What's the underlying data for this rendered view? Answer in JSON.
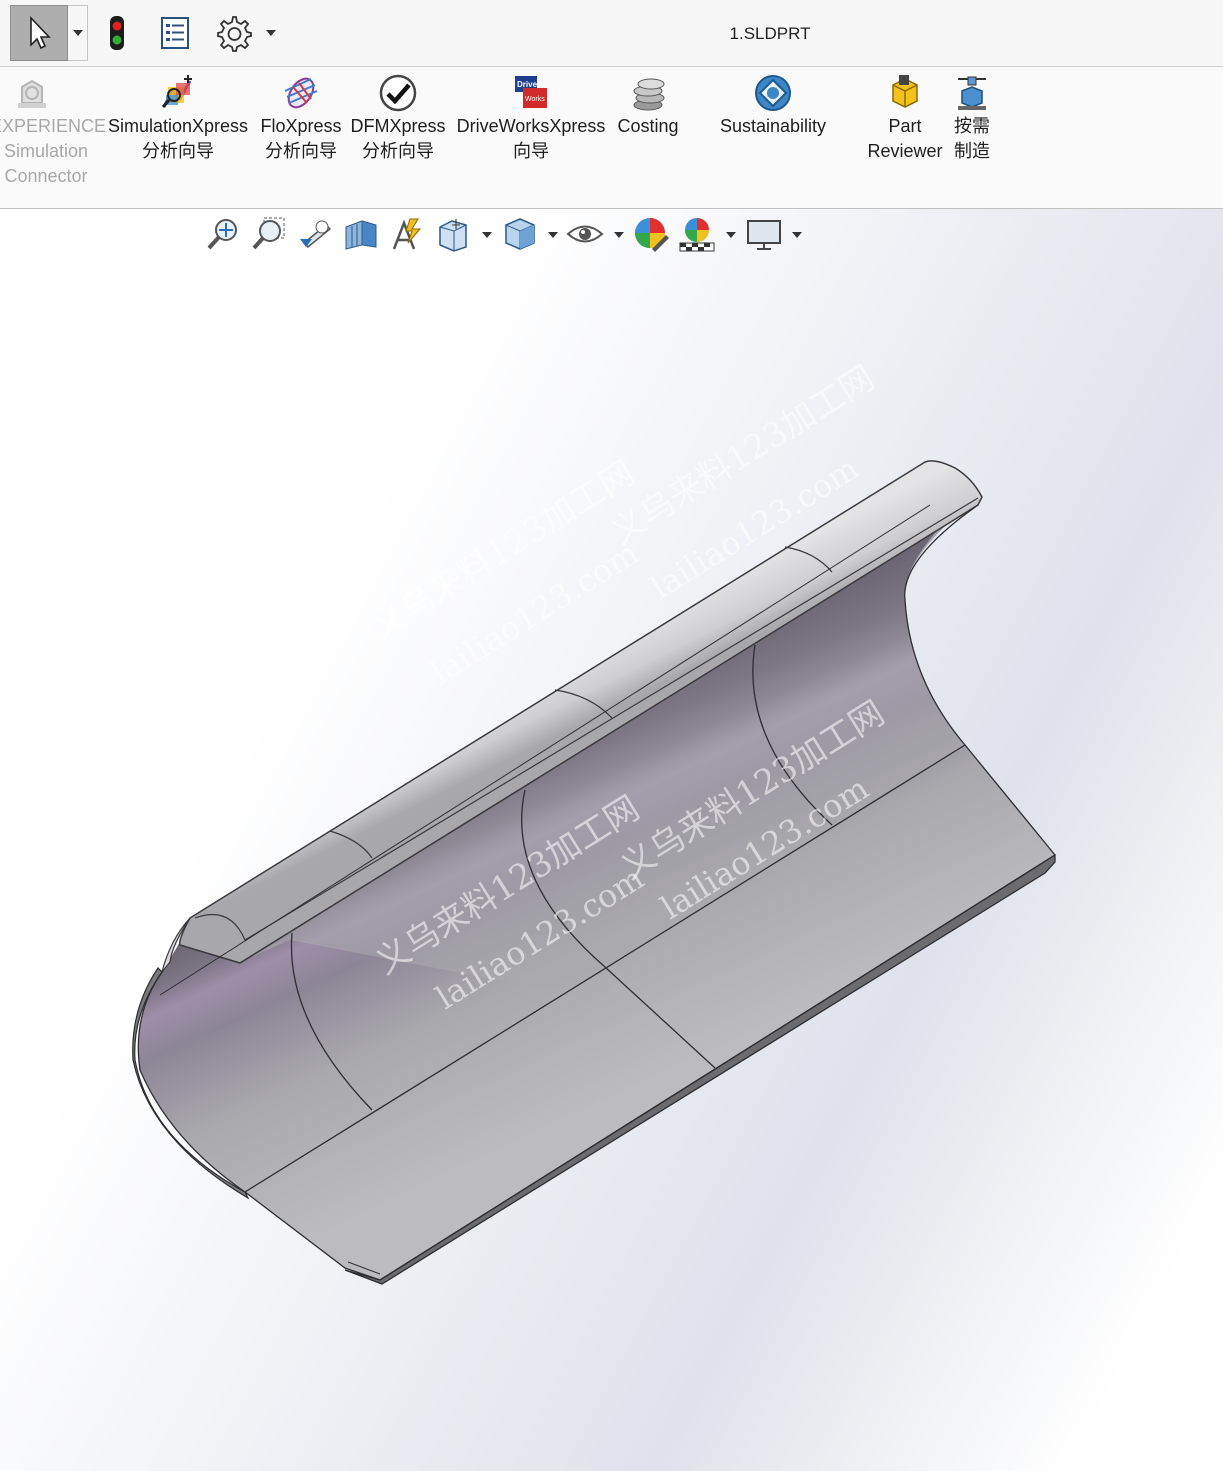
{
  "titlebar": {
    "document_title": "1.SLDPRT",
    "icons": [
      "select-arrow-icon",
      "traffic-light-icon",
      "options-list-icon",
      "gear-icon"
    ]
  },
  "ribbon": {
    "items": [
      {
        "line1": "EXPERIENCE",
        "line2": "Simulation",
        "line3": "Connector",
        "disabled": true
      },
      {
        "line1": "SimulationXpress",
        "line2": "分析向导"
      },
      {
        "line1": "FloXpress",
        "line2": "分析向导"
      },
      {
        "line1": "DFMXpress",
        "line2": "分析向导"
      },
      {
        "line1": "DriveWorksXpress",
        "line2": "向导"
      },
      {
        "line1": "Costing"
      },
      {
        "line1": "Sustainability"
      },
      {
        "line1": "Part",
        "line2": "Reviewer"
      },
      {
        "line1": "按需",
        "line2": "制造"
      }
    ]
  },
  "heads_up_toolbar": {
    "icons": [
      "zoom-to-fit-icon",
      "zoom-area-icon",
      "previous-view-icon",
      "section-view-icon",
      "dynamic-annotation-icon",
      "view-orientation-icon",
      "display-style-icon",
      "hide-show-icon",
      "edit-appearance-icon",
      "apply-scene-icon",
      "view-settings-icon"
    ]
  },
  "watermark": {
    "line1": "义乌来料123加工网",
    "line2": "lailiao123.com"
  },
  "colors": {
    "select_active": "#aeaeae",
    "model_surface": "#b8b8bc",
    "model_dark": "#6f6c76",
    "model_highlight": "#a394ad"
  }
}
